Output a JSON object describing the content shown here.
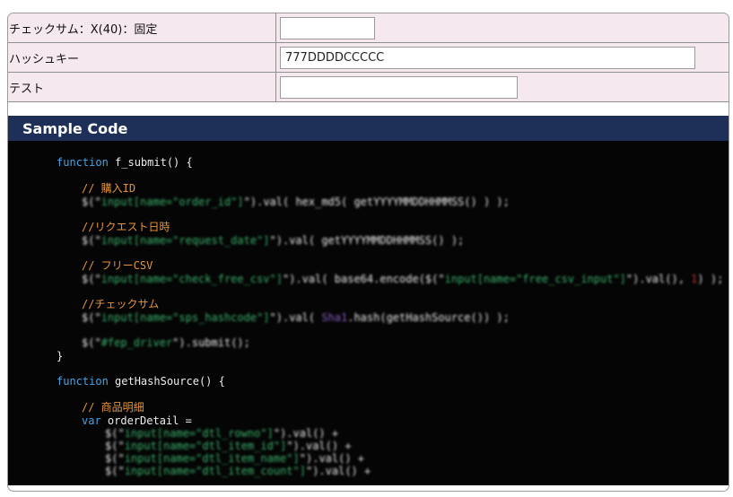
{
  "form": {
    "rows": [
      {
        "label": "チェックサム：X(40)：固定",
        "value": ""
      },
      {
        "label": "ハッシュキー",
        "value": "777DDDDCCCCC"
      },
      {
        "label": "テスト",
        "value": ""
      }
    ]
  },
  "sample_code": {
    "title": "Sample Code",
    "lines": [
      {
        "t1": "function",
        "t2": " f_submit() {"
      },
      {
        "t1": "// 購入ID"
      },
      {
        "t1": "$(\"",
        "t2": "input[name=\"order_id\"]",
        "t3": "\").val( hex_md5( getYYYYMMDDHHMMSS() ) );"
      },
      {
        "t1": "//リクエスト日時"
      },
      {
        "t1": "$(\"",
        "t2": "input[name=\"request_date\"]",
        "t3": "\").val( getYYYYMMDDHHMMSS() );"
      },
      {
        "t1": "// フリーCSV"
      },
      {
        "t1": "$(\"",
        "t2": "input[name=\"check_free_csv\"]",
        "t3": "\").val( base64.encode($(\"",
        "t4": "input[name=\"free_csv_input\"]",
        "t5": "\").val(), ",
        "t6": "1",
        "t7": ") );"
      },
      {
        "t1": "//チェックサム"
      },
      {
        "t1": "$(\"",
        "t2": "input[name=\"sps_hashcode\"]",
        "t3": "\").val( ",
        "t4": "Sha1",
        "t5": ".hash(getHashSource()) );"
      },
      {
        "t1": "$(\"",
        "t2": "#fep_driver",
        "t3": "\").submit();"
      },
      {
        "t1": "}"
      },
      {
        "t1": "function",
        "t2": " getHashSource() {"
      },
      {
        "t1": "// 商品明細"
      },
      {
        "t1": "var",
        "t2": " orderDetail ="
      },
      {
        "t1": "$(\"",
        "t2": "input[name=\"dtl_rowno\"]",
        "t3": "\").val() +"
      },
      {
        "t1": "$(\"",
        "t2": "input[name=\"dtl_item_id\"]",
        "t3": "\").val() +"
      },
      {
        "t1": "$(\"",
        "t2": "input[name=\"dtl_item_name\"]",
        "t3": "\").val() +"
      },
      {
        "t1": "$(\"",
        "t2": "input[name=\"dtl_item_count\"]",
        "t3": "\").val() +"
      }
    ]
  },
  "colors": {
    "label_bg": "#f6e8ef",
    "header_bg": "#1e2f58",
    "code_bg": "#050505",
    "keyword": "#46a4e6",
    "comment": "#e59439",
    "string": "#3bb36c",
    "plain": "#ececec"
  }
}
